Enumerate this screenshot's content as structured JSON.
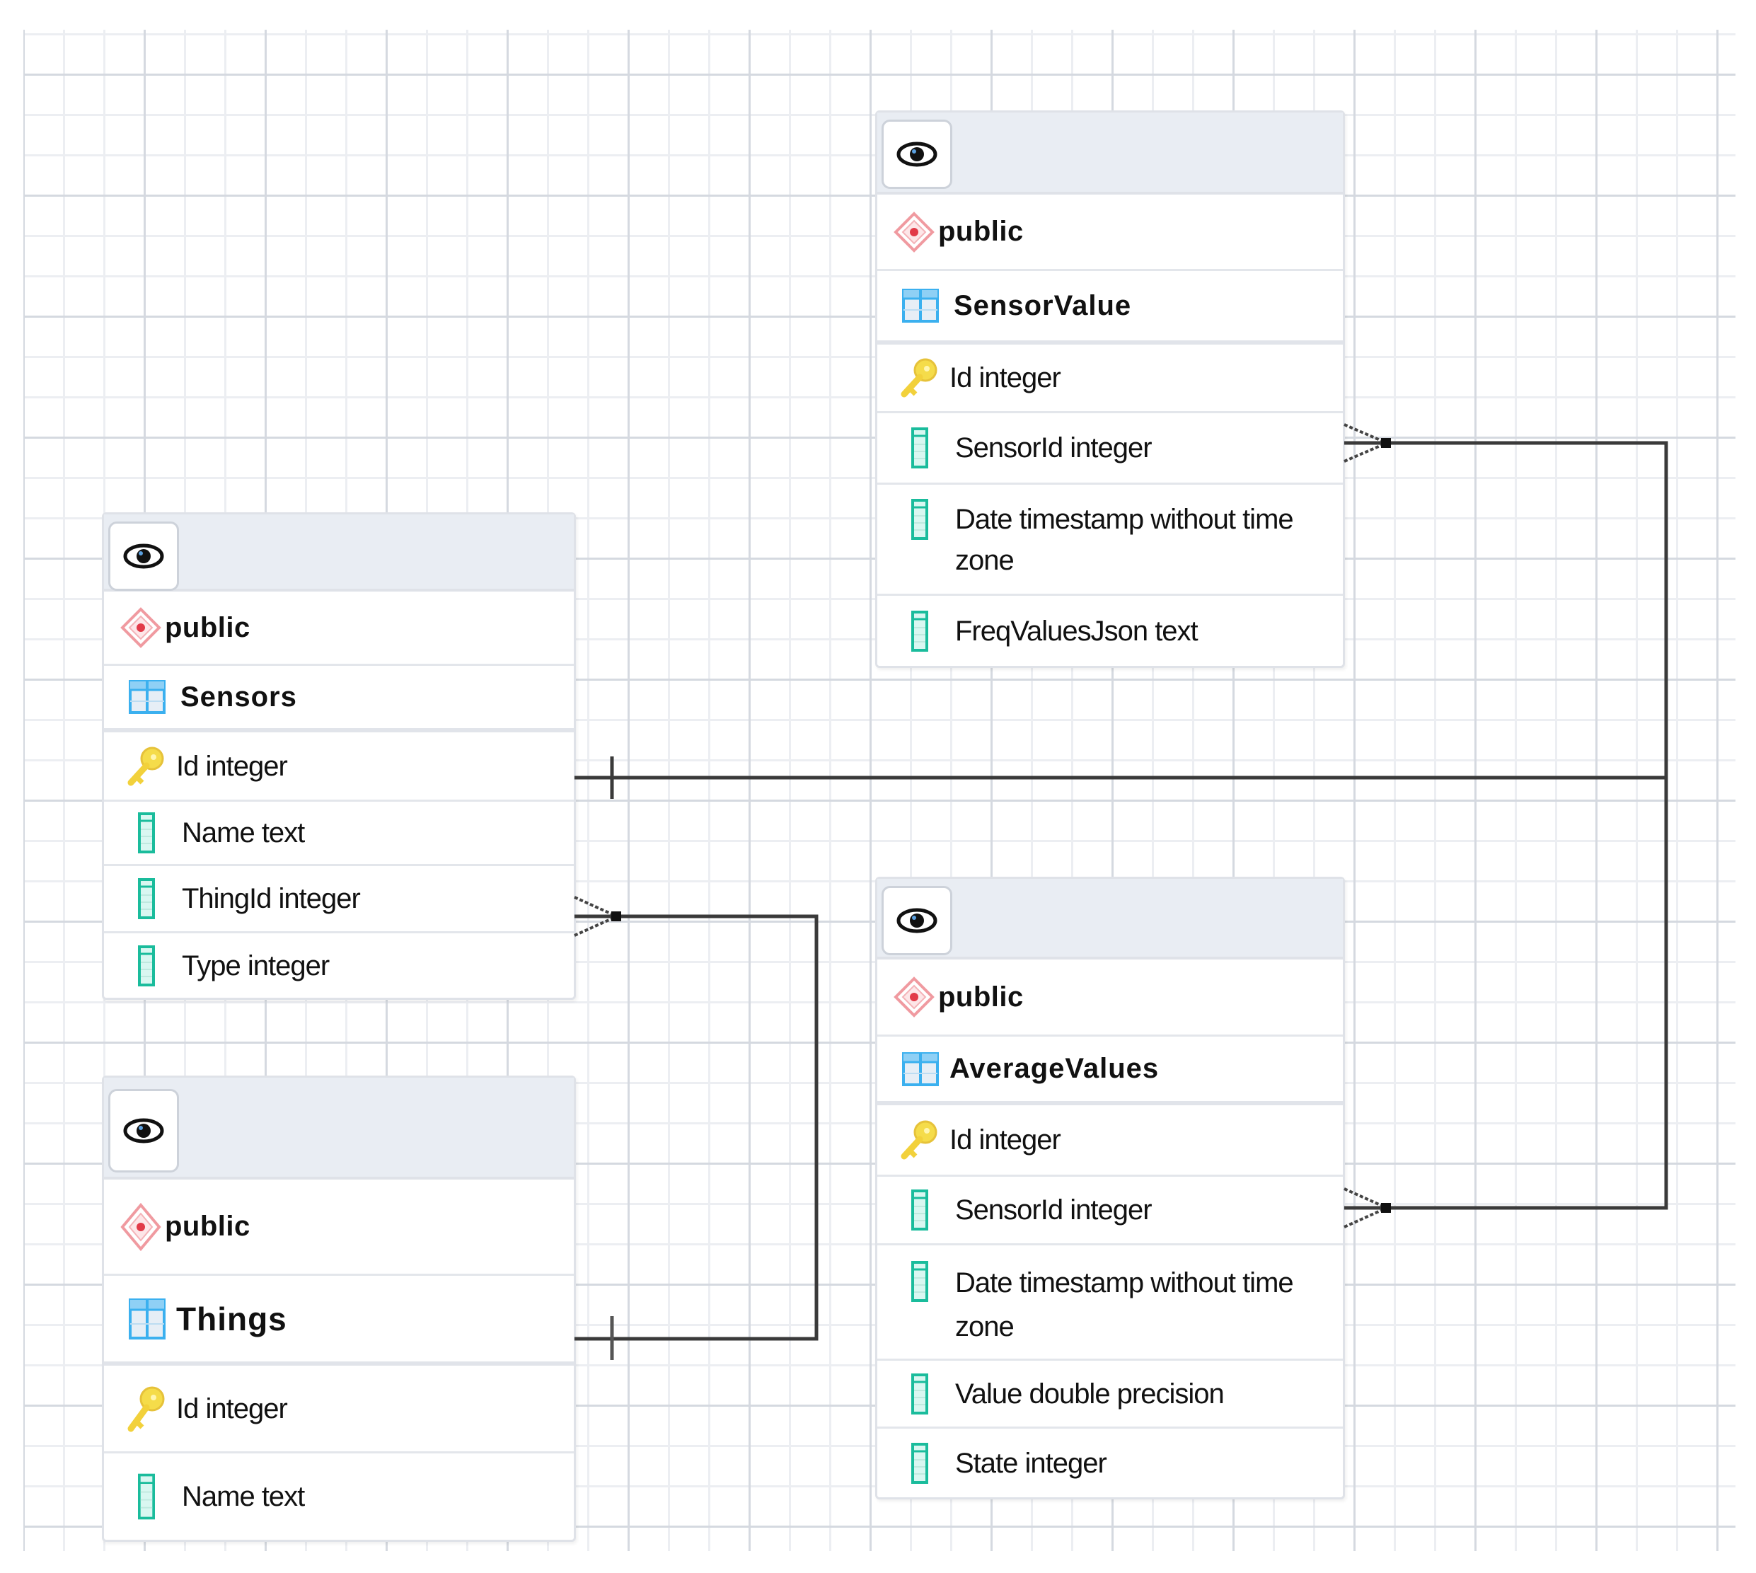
{
  "diagram": {
    "type": "entity-relationship",
    "tables": [
      {
        "id": "sensorvalue",
        "schema": "public",
        "name": "SensorValue",
        "columns": [
          {
            "label": "Id integer",
            "kind": "primary-key"
          },
          {
            "label": "SensorId integer",
            "kind": "column"
          },
          {
            "label": "Date timestamp without time zone",
            "kind": "column"
          },
          {
            "label": "FreqValuesJson text",
            "kind": "column"
          }
        ]
      },
      {
        "id": "sensors",
        "schema": "public",
        "name": "Sensors",
        "columns": [
          {
            "label": "Id integer",
            "kind": "primary-key"
          },
          {
            "label": "Name text",
            "kind": "column"
          },
          {
            "label": "ThingId integer",
            "kind": "column"
          },
          {
            "label": "Type integer",
            "kind": "column"
          }
        ]
      },
      {
        "id": "things",
        "schema": "public",
        "name": "Things",
        "columns": [
          {
            "label": "Id integer",
            "kind": "primary-key"
          },
          {
            "label": "Name text",
            "kind": "column"
          }
        ]
      },
      {
        "id": "averagevalues",
        "schema": "public",
        "name": "AverageValues",
        "columns": [
          {
            "label": "Id integer",
            "kind": "primary-key"
          },
          {
            "label": "SensorId integer",
            "kind": "column"
          },
          {
            "label": "Date timestamp without time zone",
            "kind": "column"
          },
          {
            "label": "Value double precision",
            "kind": "column"
          },
          {
            "label": "State integer",
            "kind": "column"
          }
        ]
      }
    ],
    "relationships": [
      {
        "from": "Sensors.Id",
        "to": "SensorValue.SensorId",
        "from_cardinality": "one",
        "to_cardinality": "many"
      },
      {
        "from": "Sensors.Id",
        "to": "AverageValues.SensorId",
        "from_cardinality": "one",
        "to_cardinality": "many"
      },
      {
        "from": "Things.Id",
        "to": "Sensors.ThingId",
        "from_cardinality": "one",
        "to_cardinality": "many"
      }
    ],
    "icons": {
      "view_button": "eye-icon",
      "schema": "schema-diamond-icon",
      "table": "table-icon",
      "primary_key": "key-icon",
      "column": "column-icon"
    },
    "colors": {
      "schema_icon": "#e8545f",
      "table_icon": "#3bb0ef",
      "key_icon": "#f2d13b",
      "column_icon": "#1abc9c",
      "link": "#3a3a3a"
    }
  }
}
